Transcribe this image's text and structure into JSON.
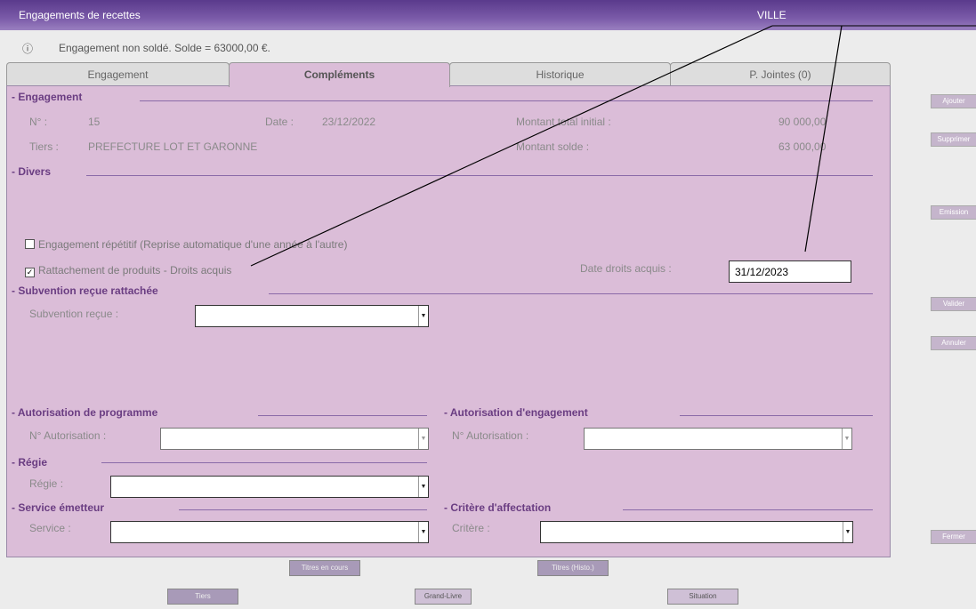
{
  "window": {
    "title": "Engagements de recettes",
    "ville": "VILLE"
  },
  "info": {
    "icon": "info-icon",
    "glyph": "ⓘ",
    "message": "Engagement non soldé. Solde = 63000,00 €."
  },
  "tabs": [
    "Engagement",
    "Compléments",
    "Historique",
    "P. Jointes (0)"
  ],
  "engagement": {
    "section": "- Engagement",
    "numero_label": "N° :",
    "numero": "15",
    "date_label": "Date :",
    "date": "23/12/2022",
    "montant_initial_label": "Montant total initial :",
    "montant_initial": "90 000,00",
    "tiers_label": "Tiers :",
    "tiers": "PREFECTURE LOT ET GARONNE",
    "montant_solde_label": "Montant solde :",
    "montant_solde": "63 000,00"
  },
  "divers": {
    "section": "- Divers",
    "repetitif_label": "Engagement répétitif (Reprise automatique d'une année à l'autre)",
    "rattachement_label": "Rattachement de produits - Droits acquis",
    "rattachement_checked": "✓",
    "date_droits_label": "Date droits acquis :",
    "date_droits": "31/12/2023"
  },
  "subvention": {
    "section": "- Subvention reçue rattachée",
    "label": "Subvention reçue :"
  },
  "programme": {
    "section": "- Autorisation de programme",
    "label": "N° Autorisation :"
  },
  "autorisation_engagement": {
    "section": "- Autorisation d'engagement",
    "label": "N° Autorisation :"
  },
  "regie": {
    "section": "- Régie",
    "label": "Régie :"
  },
  "service": {
    "section": "- Service émetteur",
    "label": "Service :"
  },
  "critere": {
    "section": "- Critère d'affectation",
    "label": "Critère :"
  },
  "side_buttons": {
    "ajouter": "Ajouter",
    "supprimer": "Supprimer",
    "emission": "Emission",
    "valider": "Valider",
    "annuler": "Annuler",
    "fermer": "Fermer"
  },
  "bottom_buttons": {
    "titres_en_cours": "Titres en cours",
    "titres_histo": "Titres (Histo.)",
    "tiers": "Tiers",
    "grand_livre": "Grand-Livre",
    "situation": "Situation"
  },
  "dropdown_arrow": "▼"
}
